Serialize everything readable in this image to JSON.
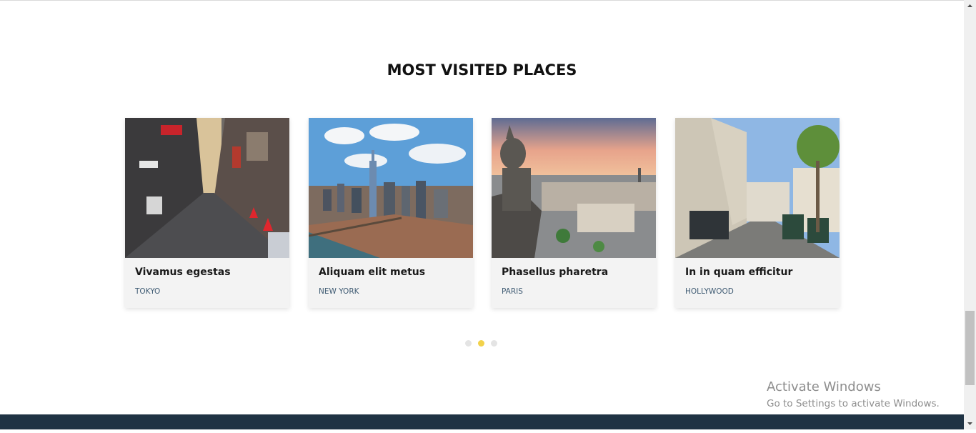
{
  "section": {
    "title": "MOST VISITED PLACES"
  },
  "cards": [
    {
      "title": "Vivamus egestas",
      "city": "TOKYO",
      "photo_icon": "tokyo-alley-photo"
    },
    {
      "title": "Aliquam elit metus",
      "city": "NEW YORK",
      "photo_icon": "new-york-skyline-photo"
    },
    {
      "title": "Phasellus pharetra",
      "city": "PARIS",
      "photo_icon": "paris-gargoyle-photo"
    },
    {
      "title": "In in quam efficitur",
      "city": "HOLLYWOOD",
      "photo_icon": "hollywood-studio-photo"
    }
  ],
  "carousel": {
    "pages": 3,
    "active_page": 2
  },
  "watermark": {
    "line1": "Activate Windows",
    "line2": "Go to Settings to activate Windows."
  },
  "colors": {
    "accent_dot": "#f2d24b",
    "footer": "#1f3344",
    "city_text": "#3f5b73"
  }
}
